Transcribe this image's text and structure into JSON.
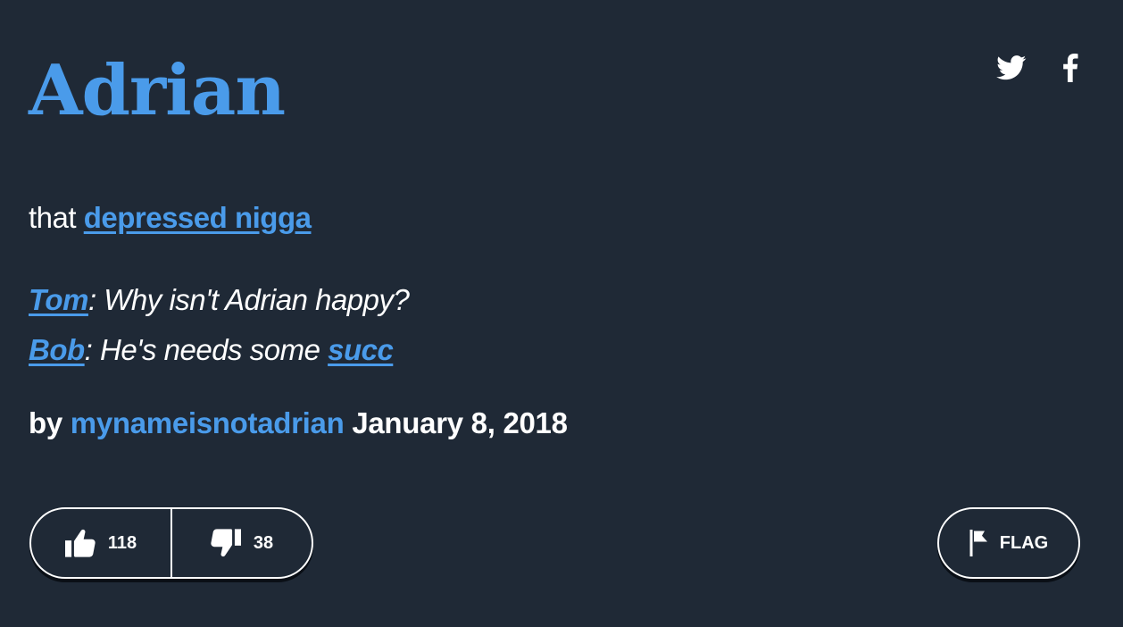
{
  "entry": {
    "word": "Adrian",
    "meaning_prefix": "that ",
    "meaning_link": "depressed nigga",
    "example": {
      "line1_name": "Tom",
      "line1_text": ": Why isn't Adrian happy?",
      "line2_name": "Bob",
      "line2_text_before": ": He's needs some ",
      "line2_link": "succ"
    },
    "by_label": "by ",
    "author": "mynameisnotadrian",
    "date": " January 8, 2018"
  },
  "share": {
    "twitter_icon": "twitter-icon",
    "facebook_icon": "facebook-icon"
  },
  "votes": {
    "up_count": "118",
    "down_count": "38"
  },
  "flag": {
    "label": "FLAG"
  },
  "colors": {
    "background": "#1f2936",
    "accent": "#4a9bea",
    "text": "#ffffff"
  }
}
